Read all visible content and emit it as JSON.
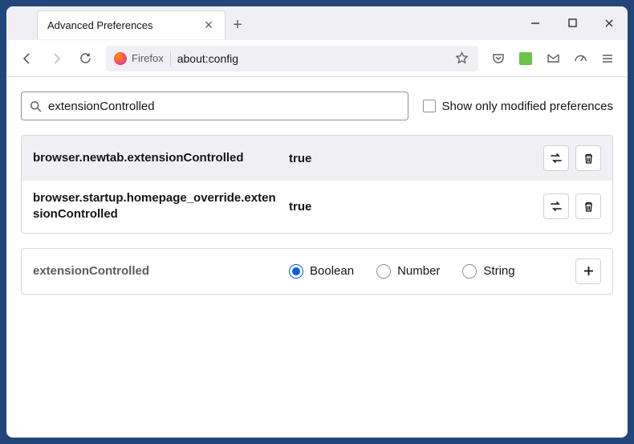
{
  "titlebar": {
    "tab_title": "Advanced Preferences"
  },
  "toolbar": {
    "identity_label": "Firefox",
    "url": "about:config"
  },
  "search": {
    "value": "extensionControlled",
    "checkbox_label": "Show only modified preferences"
  },
  "prefs": [
    {
      "name": "browser.newtab.extensionControlled",
      "value": "true"
    },
    {
      "name": "browser.startup.homepage_override.extensionControlled",
      "value": "true"
    }
  ],
  "new_pref": {
    "name": "extensionControlled",
    "types": [
      "Boolean",
      "Number",
      "String"
    ],
    "selected": "Boolean"
  }
}
